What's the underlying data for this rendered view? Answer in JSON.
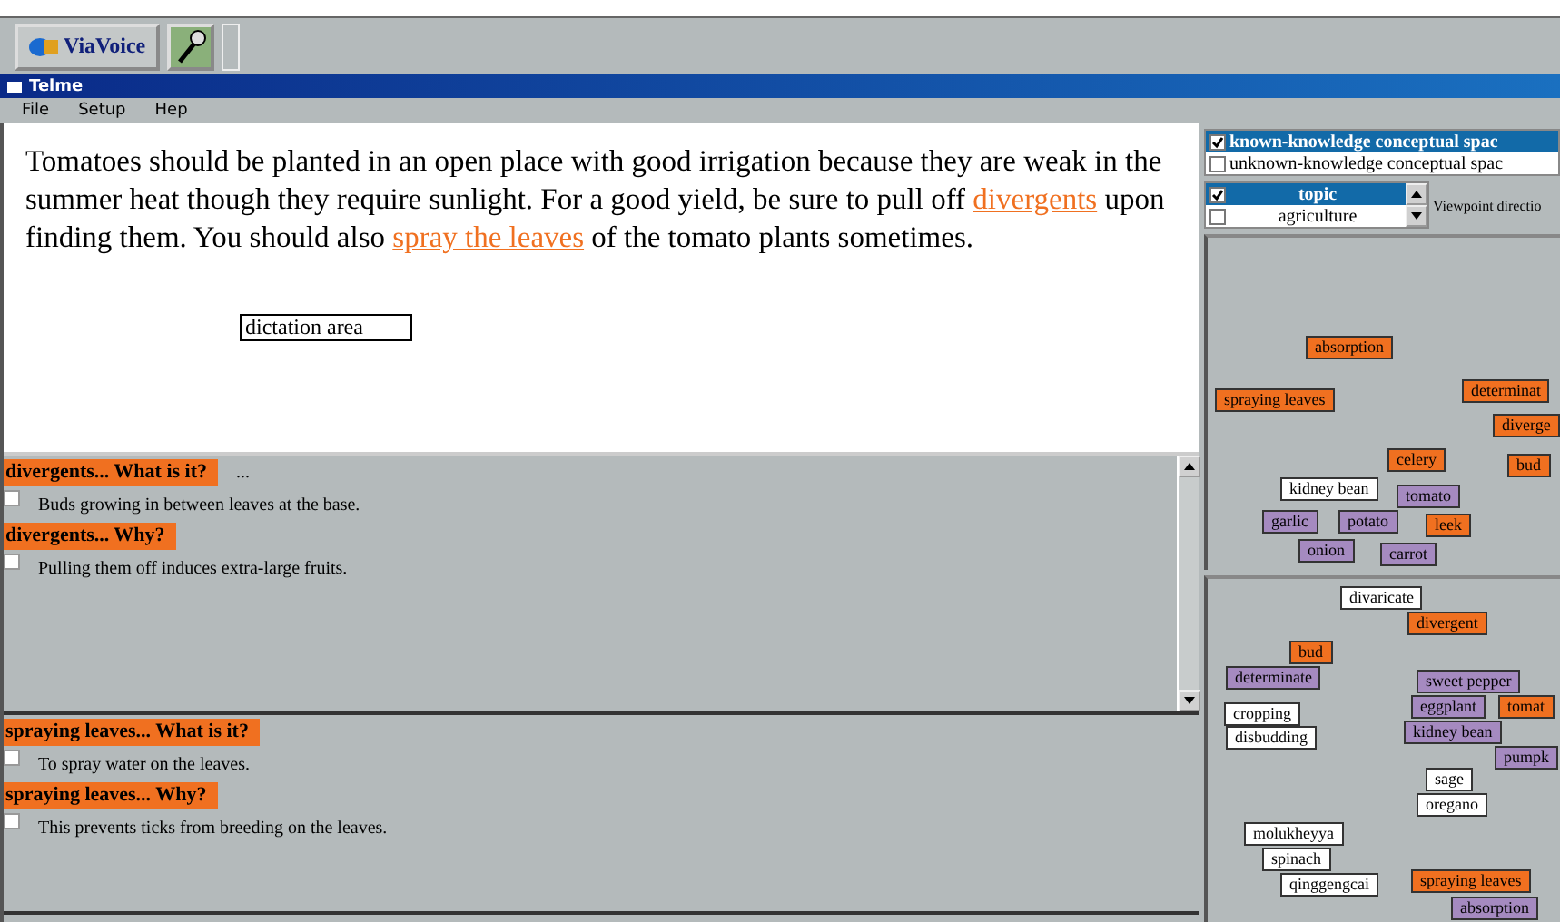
{
  "toolbar": {
    "app_button": "ViaVoice"
  },
  "window": {
    "title": "Telme"
  },
  "menu": [
    "File",
    "Setup",
    "Hep"
  ],
  "document": {
    "segments": [
      {
        "kind": "plain",
        "text": "Tomatoes should be planted in an open place with good irrigation because they are weak in the summer heat though they require sunlight. For a good yield, be sure to pull off "
      },
      {
        "kind": "link",
        "text": "divergents"
      },
      {
        "kind": "plain",
        "text": " upon finding them. You should also "
      },
      {
        "kind": "link",
        "text": "spray the leaves"
      },
      {
        "kind": "plain",
        "text": " of the tomato plants sometimes."
      }
    ],
    "dictation_label": "dictation area"
  },
  "qa_panels": [
    {
      "scrollable": true,
      "blocks": [
        {
          "heading": "divergents... What is it?",
          "trailing": "...",
          "answer": "Buds growing in between leaves at the base.",
          "checked": false
        },
        {
          "heading": "divergents... Why?",
          "answer": "Pulling them off induces extra-large fruits.",
          "checked": false
        }
      ]
    },
    {
      "scrollable": false,
      "blocks": [
        {
          "heading": "spraying leaves... What is it?",
          "answer": "To spray water on the leaves.",
          "checked": false
        },
        {
          "heading": "spraying leaves... Why?",
          "answer": "This prevents ticks from breeding on the leaves.",
          "checked": false
        }
      ]
    }
  ],
  "views": [
    {
      "label": "known-knowledge conceptual spac",
      "checked": true,
      "selected": true
    },
    {
      "label": "unknown-knowledge conceptual spac",
      "checked": false,
      "selected": false
    }
  ],
  "viewpoint": {
    "items": [
      {
        "label": "topic",
        "checked": true,
        "selected": true
      },
      {
        "label": "agriculture",
        "checked": false,
        "selected": false
      }
    ],
    "label": "Viewpoint directio"
  },
  "maps": [
    {
      "nodes": [
        {
          "text": "absorption",
          "color": "#f07020"
        },
        {
          "text": "spraying leaves",
          "color": "#f07020"
        },
        {
          "text": "determinat",
          "color": "#f07020"
        },
        {
          "text": "diverge",
          "color": "#f07020"
        },
        {
          "text": "bud",
          "color": "#f07020"
        },
        {
          "text": "celery",
          "color": "#f07020"
        },
        {
          "text": "kidney bean",
          "color": "#ffffff"
        },
        {
          "text": "garlic",
          "color": "#a58ac0"
        },
        {
          "text": "tomato",
          "color": "#a58ac0"
        },
        {
          "text": "potato",
          "color": "#a58ac0"
        },
        {
          "text": "leek",
          "color": "#f07020"
        },
        {
          "text": "onion",
          "color": "#a58ac0"
        },
        {
          "text": "carrot",
          "color": "#a58ac0"
        }
      ]
    },
    {
      "nodes": [
        {
          "text": "divaricate",
          "color": "#ffffff"
        },
        {
          "text": "divergent",
          "color": "#f07020"
        },
        {
          "text": "bud",
          "color": "#f07020"
        },
        {
          "text": "determinate",
          "color": "#a58ac0"
        },
        {
          "text": "sweet pepper",
          "color": "#a58ac0"
        },
        {
          "text": "eggplant",
          "color": "#a58ac0"
        },
        {
          "text": "tomat",
          "color": "#f07020"
        },
        {
          "text": "kidney bean",
          "color": "#a58ac0"
        },
        {
          "text": "pumpk",
          "color": "#a58ac0"
        },
        {
          "text": "cropping",
          "color": "#ffffff"
        },
        {
          "text": "disbudding",
          "color": "#ffffff"
        },
        {
          "text": "sage",
          "color": "#ffffff"
        },
        {
          "text": "oregano",
          "color": "#ffffff"
        },
        {
          "text": "molukheyya",
          "color": "#ffffff"
        },
        {
          "text": "spinach",
          "color": "#ffffff"
        },
        {
          "text": "qinggengcai",
          "color": "#ffffff"
        },
        {
          "text": "spraying leaves",
          "color": "#f07020"
        },
        {
          "text": "absorption",
          "color": "#a58ac0"
        }
      ]
    }
  ]
}
